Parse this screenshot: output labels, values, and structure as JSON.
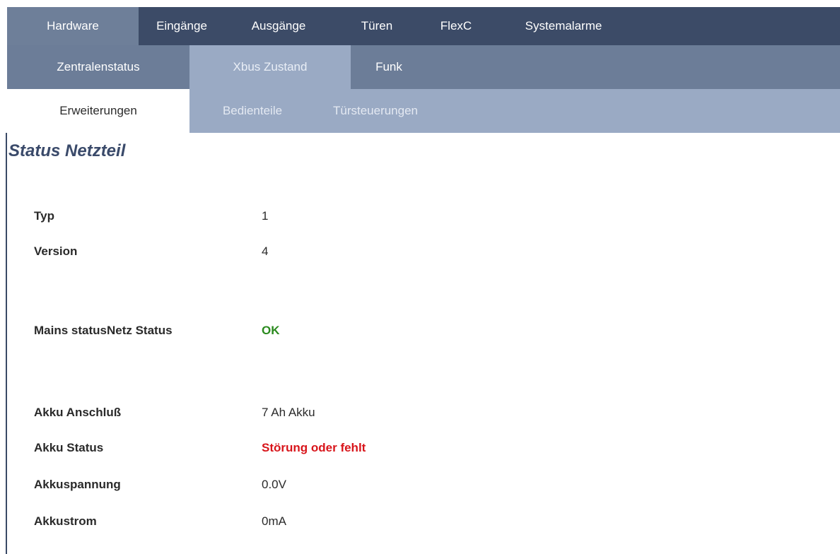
{
  "nav": {
    "main_tabs": [
      {
        "label": "Hardware",
        "active": true
      },
      {
        "label": "Eingänge",
        "active": false
      },
      {
        "label": "Ausgänge",
        "active": false
      },
      {
        "label": "Türen",
        "active": false
      },
      {
        "label": "FlexC",
        "active": false
      },
      {
        "label": "Systemalarme",
        "active": false
      }
    ],
    "sub_tabs": [
      {
        "label": "Zentralenstatus",
        "active": false
      },
      {
        "label": "Xbus Zustand",
        "active": true
      },
      {
        "label": "Funk",
        "active": false
      }
    ],
    "sub_sub_tabs": [
      {
        "label": "Erweiterungen",
        "active": true
      },
      {
        "label": "Bedienteile",
        "active": false
      },
      {
        "label": "Türsteuerungen",
        "active": false
      }
    ]
  },
  "page": {
    "title": "Status Netzteil"
  },
  "status": {
    "typ": {
      "label": "Typ",
      "value": "1"
    },
    "version": {
      "label": "Version",
      "value": "4"
    },
    "mains": {
      "label": "Mains statusNetz Status",
      "value": "OK"
    },
    "akku_anschluss": {
      "label": "Akku Anschluß",
      "value": "7 Ah Akku"
    },
    "akku_status": {
      "label": "Akku Status",
      "value": "Störung oder fehlt"
    },
    "akkuspannung": {
      "label": "Akkuspannung",
      "value": "0.0V"
    },
    "akkustrom": {
      "label": "Akkustrom",
      "value": "0mA"
    }
  },
  "colors": {
    "nav_dark": "#3c4b67",
    "nav_mid": "#6c7d98",
    "nav_light": "#9aaac4",
    "title": "#3a4a6a",
    "ok": "#2a8a1e",
    "error": "#d8151b"
  }
}
